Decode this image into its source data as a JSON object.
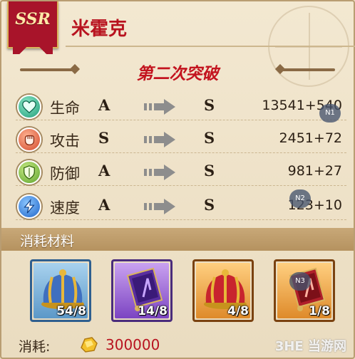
{
  "header": {
    "rarity": "SSR",
    "hero_name": "米霍克"
  },
  "title": "第二次突破",
  "stats": [
    {
      "name": "生命",
      "icon": "heart-icon",
      "from_grade": "A",
      "to_grade": "S",
      "value": "13541+540"
    },
    {
      "name": "攻击",
      "icon": "fist-icon",
      "from_grade": "S",
      "to_grade": "S",
      "value": "2451+72"
    },
    {
      "name": "防御",
      "icon": "shield-icon",
      "from_grade": "A",
      "to_grade": "S",
      "value": "981+27"
    },
    {
      "name": "速度",
      "icon": "lightning-icon",
      "from_grade": "A",
      "to_grade": "S",
      "value": "123+10"
    }
  ],
  "badges": [
    "N1",
    "N2",
    "N3"
  ],
  "materials": {
    "title": "消耗材料",
    "items": [
      {
        "icon": "blue-crown-icon",
        "count": "54/8",
        "frame": "blue"
      },
      {
        "icon": "purple-book-icon",
        "count": "14/8",
        "frame": "purple"
      },
      {
        "icon": "red-crown-icon",
        "count": "4/8",
        "frame": "orange"
      },
      {
        "icon": "red-book-icon",
        "count": "1/8",
        "frame": "orange"
      }
    ]
  },
  "cost": {
    "label": "消耗:",
    "icon": "gold-coin-icon",
    "amount": "300000"
  },
  "watermark": "3HE 当游网",
  "colors": {
    "accent_red": "#b8131f",
    "gold_frame": "#d9b45c",
    "material_bar": "#b5925f"
  }
}
